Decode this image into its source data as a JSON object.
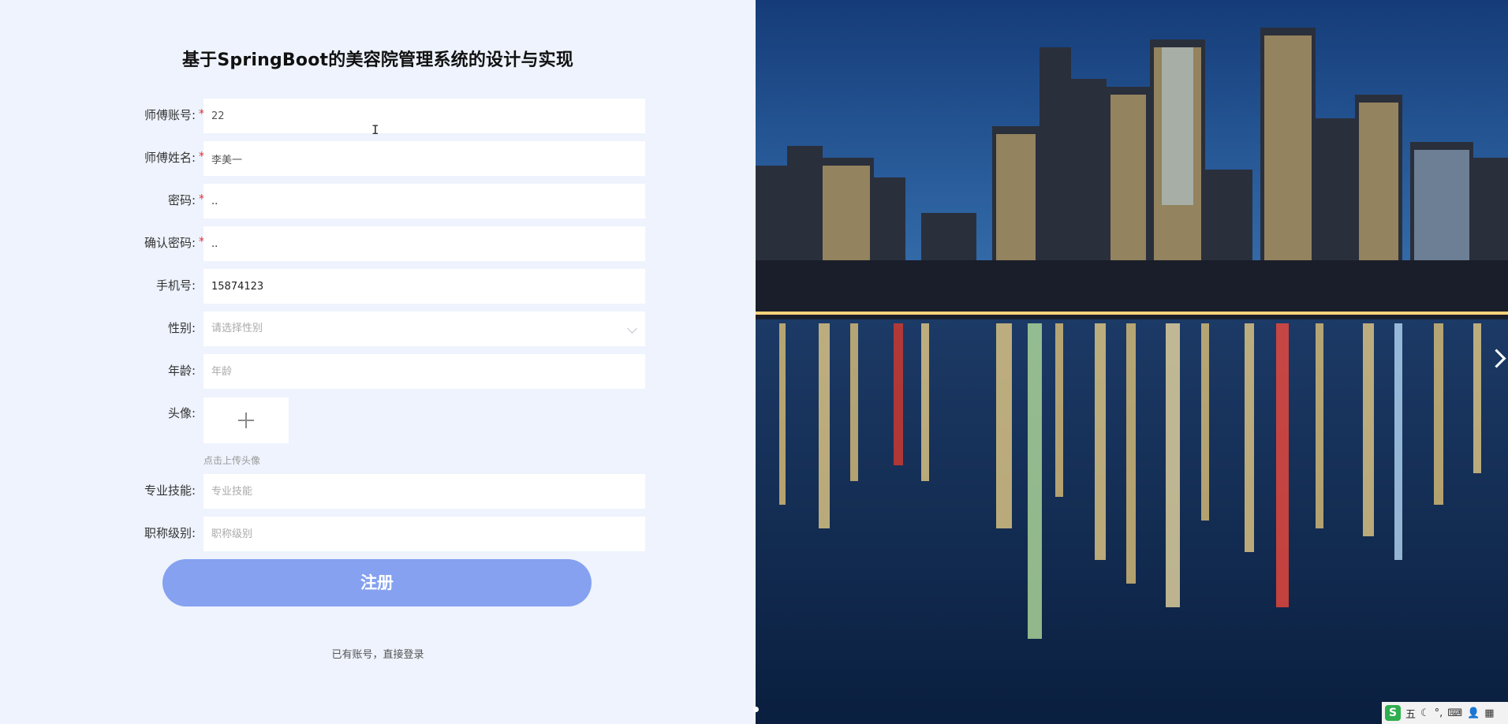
{
  "page": {
    "title": "基于SpringBoot的美容院管理系统的设计与实现"
  },
  "form": {
    "account": {
      "label": "师傅账号:",
      "required": "*",
      "value": "22"
    },
    "name": {
      "label": "师傅姓名:",
      "required": "*",
      "value": "李美一"
    },
    "password": {
      "label": "密码:",
      "required": "*",
      "value": ".."
    },
    "confirm_password": {
      "label": "确认密码:",
      "required": "*",
      "value": ".."
    },
    "phone": {
      "label": "手机号:",
      "value": "15874123"
    },
    "gender": {
      "label": "性别:",
      "placeholder": "请选择性别"
    },
    "age": {
      "label": "年龄:",
      "placeholder": "年龄"
    },
    "avatar": {
      "label": "头像:",
      "hint": "点击上传头像"
    },
    "skill": {
      "label": "专业技能:",
      "placeholder": "专业技能"
    },
    "title_level": {
      "label": "职称级别:",
      "placeholder": "职称级别"
    }
  },
  "actions": {
    "register": "注册",
    "login_link": "已有账号，直接登录"
  },
  "ime": {
    "logo": "S",
    "mode": "五"
  },
  "colors": {
    "page_bg": "#eef3fd",
    "button_bg": "#85a1f0",
    "required": "#e23a3a"
  }
}
